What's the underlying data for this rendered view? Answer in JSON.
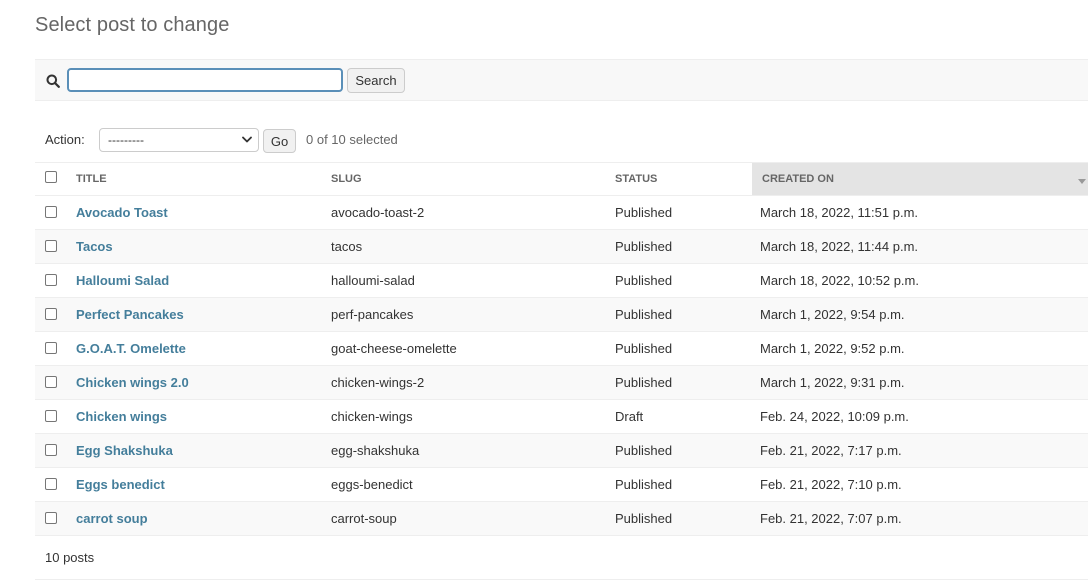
{
  "page": {
    "title": "Select post to change"
  },
  "search": {
    "value": "",
    "placeholder": "",
    "button_label": "Search",
    "icon": "search-icon"
  },
  "actions": {
    "label": "Action:",
    "selected_option": "---------",
    "go_label": "Go",
    "selected_count_text": "0 of 10 selected"
  },
  "table": {
    "headers": {
      "title": "Title",
      "slug": "Slug",
      "status": "Status",
      "created_on": "Created on"
    },
    "sorted_column": "created_on",
    "rows": [
      {
        "title": "Avocado Toast",
        "slug": "avocado-toast-2",
        "status": "Published",
        "created_on": "March 18, 2022, 11:51 p.m."
      },
      {
        "title": "Tacos",
        "slug": "tacos",
        "status": "Published",
        "created_on": "March 18, 2022, 11:44 p.m."
      },
      {
        "title": "Halloumi Salad",
        "slug": "halloumi-salad",
        "status": "Published",
        "created_on": "March 18, 2022, 10:52 p.m."
      },
      {
        "title": "Perfect Pancakes",
        "slug": "perf-pancakes",
        "status": "Published",
        "created_on": "March 1, 2022, 9:54 p.m."
      },
      {
        "title": "G.O.A.T. Omelette",
        "slug": "goat-cheese-omelette",
        "status": "Published",
        "created_on": "March 1, 2022, 9:52 p.m."
      },
      {
        "title": "Chicken wings 2.0",
        "slug": "chicken-wings-2",
        "status": "Published",
        "created_on": "March 1, 2022, 9:31 p.m."
      },
      {
        "title": "Chicken wings",
        "slug": "chicken-wings",
        "status": "Draft",
        "created_on": "Feb. 24, 2022, 10:09 p.m."
      },
      {
        "title": "Egg Shakshuka",
        "slug": "egg-shakshuka",
        "status": "Published",
        "created_on": "Feb. 21, 2022, 7:17 p.m."
      },
      {
        "title": "Eggs benedict",
        "slug": "eggs-benedict",
        "status": "Published",
        "created_on": "Feb. 21, 2022, 7:10 p.m."
      },
      {
        "title": "carrot soup",
        "slug": "carrot-soup",
        "status": "Published",
        "created_on": "Feb. 21, 2022, 7:07 p.m."
      }
    ]
  },
  "paginator": {
    "text": "10 posts"
  },
  "colors": {
    "link": "#447e9b",
    "search_focus_border": "#5a8fb8",
    "sorted_header_bg": "#e4e4e4",
    "row_alt_bg": "#f9f9f9"
  }
}
